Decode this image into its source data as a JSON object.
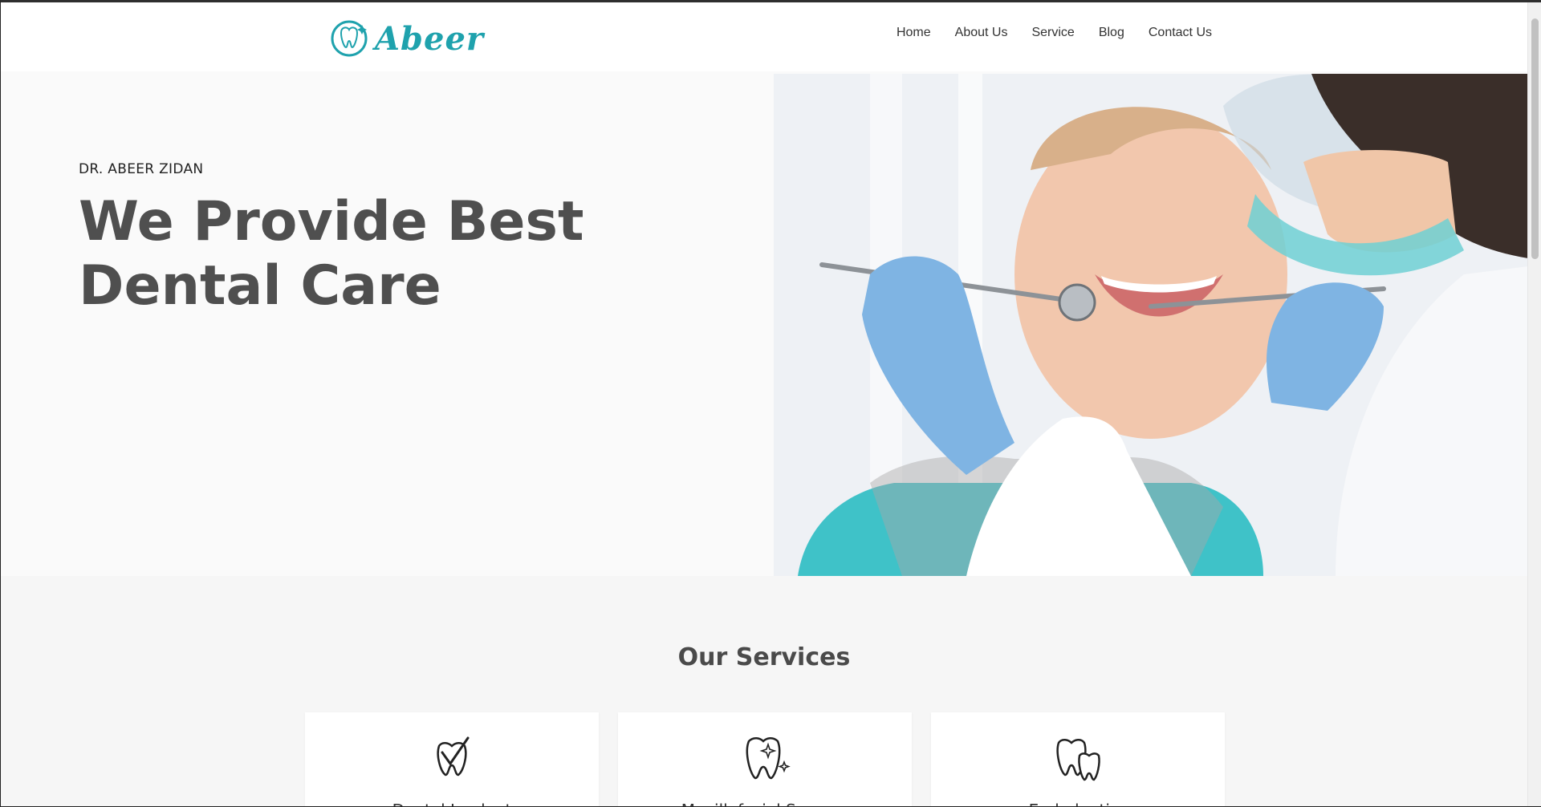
{
  "brand": {
    "name": "Abeer",
    "accent": "#1fa2ad"
  },
  "nav": {
    "items": [
      {
        "label": "Home"
      },
      {
        "label": "About Us"
      },
      {
        "label": "Service"
      },
      {
        "label": "Blog"
      },
      {
        "label": "Contact Us"
      }
    ]
  },
  "hero": {
    "kicker": "DR. ABEER ZIDAN",
    "headline": "We Provide Best Dental Care",
    "image_icon": "dentist-photo"
  },
  "services": {
    "title": "Our Services",
    "cards": [
      {
        "title": "Dental Implant",
        "icon": "tooth-check-icon"
      },
      {
        "title": "Maxillofacial Surgery",
        "icon": "tooth-sparkle-icon"
      },
      {
        "title": "Endodontics",
        "icon": "two-teeth-icon"
      }
    ]
  }
}
